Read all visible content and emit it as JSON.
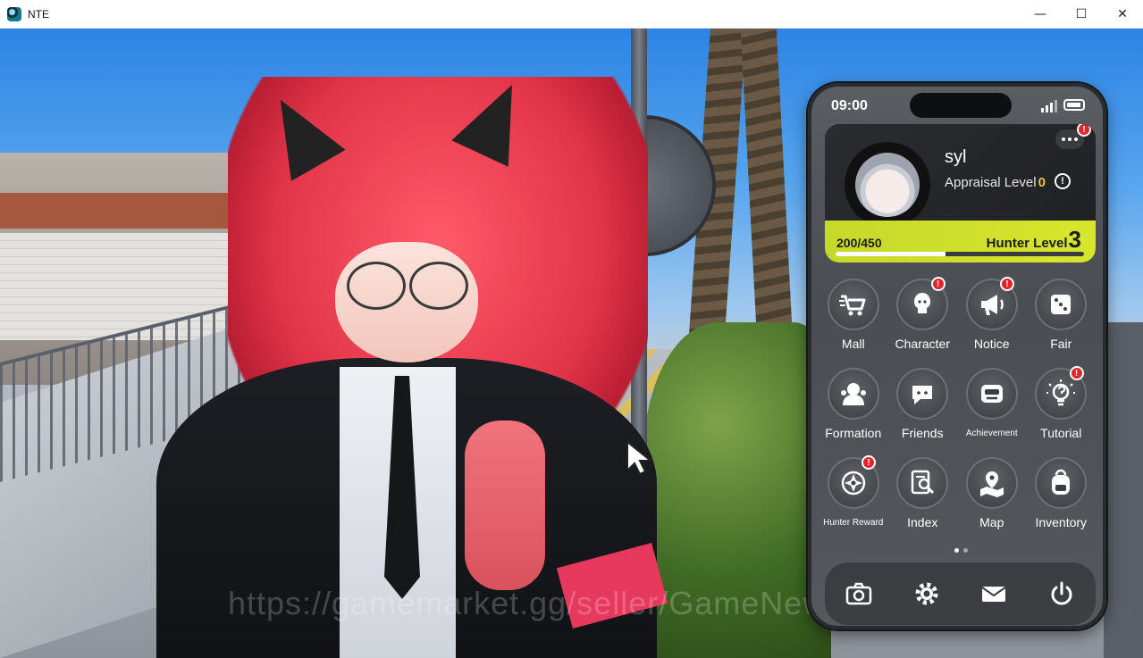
{
  "window": {
    "title": "NTE",
    "minimize": "—",
    "maximize": "☐",
    "close": "✕"
  },
  "watermark": "https://gamemarket.gg/seller/GameNews",
  "phone": {
    "time": "09:00",
    "profile": {
      "name": "syl",
      "appraisal_label": "Appraisal Level",
      "appraisal_value": "0",
      "exp_text": "200/450",
      "exp_fraction": 0.444,
      "hunter_level_label": "Hunter Level",
      "hunter_level_value": "3"
    },
    "apps": [
      {
        "label": "Mall",
        "icon": "cart-icon",
        "alert": false
      },
      {
        "label": "Character",
        "icon": "character-icon",
        "alert": true
      },
      {
        "label": "Notice",
        "icon": "megaphone-icon",
        "alert": true
      },
      {
        "label": "Fair",
        "icon": "dice-icon",
        "alert": false
      },
      {
        "label": "Formation",
        "icon": "formation-icon",
        "alert": false
      },
      {
        "label": "Friends",
        "icon": "chat-bubble-icon",
        "alert": false
      },
      {
        "label": "Achievement",
        "icon": "achievement-icon",
        "alert": false
      },
      {
        "label": "Tutorial",
        "icon": "lightbulb-icon",
        "alert": true
      },
      {
        "label": "Hunter Reward",
        "icon": "compass-icon",
        "alert": true
      },
      {
        "label": "Index",
        "icon": "index-search-icon",
        "alert": false
      },
      {
        "label": "Map",
        "icon": "map-pin-icon",
        "alert": false
      },
      {
        "label": "Inventory",
        "icon": "backpack-icon",
        "alert": false
      }
    ],
    "dock": [
      "camera-icon",
      "settings-gear-icon",
      "mail-icon",
      "power-icon"
    ],
    "alert_mark": "!",
    "colors": {
      "level_bar": "#d7e62d",
      "alert": "#e4242c",
      "appraisal_value": "#e6c72a"
    }
  }
}
